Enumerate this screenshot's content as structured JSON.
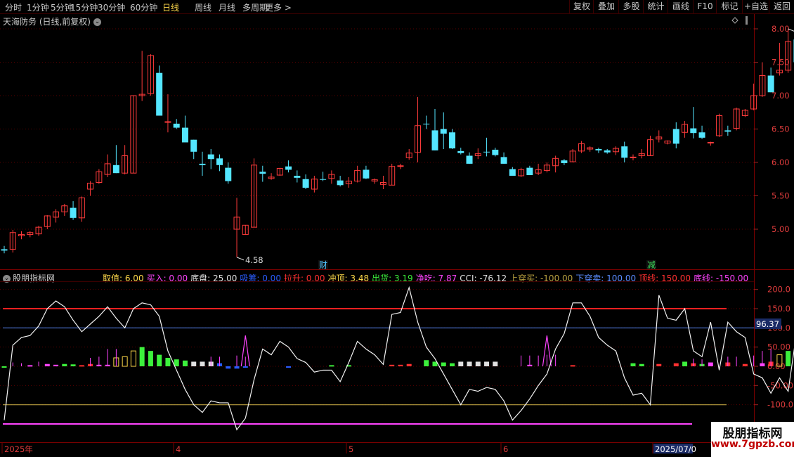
{
  "toolbar": {
    "periods": [
      "分时",
      "1分钟",
      "5分钟",
      "15分钟",
      "30分钟",
      "60分钟",
      "日线",
      "周线",
      "月线",
      "多周期",
      "更多 >"
    ],
    "active": "日线",
    "right": [
      "复权",
      "叠加",
      "多股",
      "统计",
      "画线",
      "F10",
      "标记",
      "+自选",
      "返回"
    ]
  },
  "main": {
    "title": "天海防务 (日线,前复权)",
    "y_ticks": [
      "8.00",
      "7.50",
      "7.00",
      "6.50",
      "6.00",
      "5.50",
      "5.00"
    ],
    "max_label": "8.00",
    "min_label": "4.58",
    "markers": [
      {
        "text": "财",
        "color": "#4fc3ff"
      },
      {
        "text": "减",
        "color": "#3cd85a"
      }
    ]
  },
  "indicator": {
    "title": "股朋指标网",
    "legend": [
      {
        "text": "取值: 6.00",
        "color": "#ffd94a"
      },
      {
        "text": "买入: 0.00",
        "color": "#ff44ff"
      },
      {
        "text": "底盘: 25.00",
        "color": "#e0e0e0"
      },
      {
        "text": "吸筹: 0.00",
        "color": "#2a5cff"
      },
      {
        "text": "拉升: 0.00",
        "color": "#ff3030"
      },
      {
        "text": "冲顶: 3.48",
        "color": "#ffd94a"
      },
      {
        "text": "出货: 3.19",
        "color": "#3cf03c"
      },
      {
        "text": "净吃: 7.87",
        "color": "#ff44ff"
      },
      {
        "text": "CCI: -76.12",
        "color": "#e0e0e0"
      },
      {
        "text": "上穿买: -100.00",
        "color": "#b8a040"
      },
      {
        "text": "下穿卖: 100.00",
        "color": "#5a8cff"
      },
      {
        "text": "顶线: 150.00",
        "color": "#ff3030"
      },
      {
        "text": "底线: -150.00",
        "color": "#ff44ff"
      }
    ],
    "y_ticks": [
      "200.0",
      "150.0",
      "100.0",
      "50.00",
      "0.00",
      "-50.00",
      "-100.0"
    ],
    "current_value": "96.37"
  },
  "time_axis": [
    "2025年",
    "4",
    "5",
    "6",
    "2025/07/0"
  ],
  "watermark": {
    "line1": "股朋指标网",
    "line2": "www.7gpzb.com"
  },
  "colors": {
    "up": "#ff3b3b",
    "down": "#54e6ff",
    "grid": "#5a0000"
  },
  "chart_data": {
    "type": "candlestick",
    "ohlc": [
      [
        4.7,
        4.75,
        4.64,
        4.68
      ],
      [
        4.7,
        4.99,
        4.65,
        4.95
      ],
      [
        4.9,
        4.97,
        4.85,
        4.92
      ],
      [
        4.92,
        4.97,
        4.88,
        4.95
      ],
      [
        4.93,
        5.05,
        4.9,
        5.03
      ],
      [
        5.04,
        5.21,
        5.0,
        5.2
      ],
      [
        5.18,
        5.3,
        5.1,
        5.26
      ],
      [
        5.26,
        5.38,
        5.2,
        5.35
      ],
      [
        5.32,
        5.42,
        5.14,
        5.17
      ],
      [
        5.17,
        5.49,
        5.11,
        5.47
      ],
      [
        5.6,
        5.72,
        5.5,
        5.69
      ],
      [
        5.7,
        5.9,
        5.68,
        5.86
      ],
      [
        5.82,
        6.12,
        5.78,
        5.98
      ],
      [
        5.96,
        6.26,
        5.84,
        5.84
      ],
      [
        5.84,
        6.26,
        5.82,
        6.1
      ],
      [
        5.84,
        7.0,
        5.84,
        7.0
      ],
      [
        7.0,
        7.67,
        6.92,
        7.02
      ],
      [
        7.03,
        7.62,
        7.0,
        7.6
      ],
      [
        7.34,
        7.45,
        6.7,
        6.7
      ],
      [
        6.6,
        7.02,
        6.45,
        6.61
      ],
      [
        6.58,
        6.65,
        6.5,
        6.52
      ],
      [
        6.52,
        6.7,
        6.3,
        6.3
      ],
      [
        6.34,
        6.34,
        6.05,
        6.16
      ],
      [
        5.98,
        6.16,
        5.8,
        5.96
      ],
      [
        6.12,
        6.2,
        5.9,
        6.05
      ],
      [
        6.06,
        6.12,
        5.87,
        5.96
      ],
      [
        5.92,
        6.0,
        5.68,
        5.72
      ],
      [
        5.0,
        5.47,
        4.58,
        5.18
      ],
      [
        4.92,
        5.06,
        4.92,
        5.06
      ],
      [
        5.03,
        6.06,
        5.03,
        5.96
      ],
      [
        5.86,
        5.95,
        5.71,
        5.83
      ],
      [
        5.76,
        5.84,
        5.74,
        5.78
      ],
      [
        5.81,
        5.92,
        5.8,
        5.91
      ],
      [
        5.94,
        6.03,
        5.85,
        5.89
      ],
      [
        5.8,
        5.88,
        5.7,
        5.77
      ],
      [
        5.75,
        5.82,
        5.6,
        5.62
      ],
      [
        5.6,
        5.8,
        5.55,
        5.75
      ],
      [
        5.75,
        5.86,
        5.72,
        5.74
      ],
      [
        5.76,
        5.88,
        5.68,
        5.82
      ],
      [
        5.73,
        5.8,
        5.64,
        5.66
      ],
      [
        5.68,
        5.78,
        5.62,
        5.72
      ],
      [
        5.72,
        5.95,
        5.7,
        5.88
      ],
      [
        5.89,
        5.95,
        5.75,
        5.76
      ],
      [
        5.72,
        5.76,
        5.68,
        5.74
      ],
      [
        5.67,
        5.8,
        5.6,
        5.7
      ],
      [
        5.66,
        5.98,
        5.66,
        5.94
      ],
      [
        5.94,
        5.98,
        5.9,
        5.95
      ],
      [
        6.07,
        6.2,
        6.04,
        6.14
      ],
      [
        6.15,
        6.98,
        6.0,
        6.55
      ],
      [
        6.58,
        6.7,
        6.5,
        6.57
      ],
      [
        6.48,
        6.8,
        6.18,
        6.18
      ],
      [
        6.5,
        6.75,
        6.2,
        6.43
      ],
      [
        6.45,
        6.5,
        6.2,
        6.21
      ],
      [
        6.17,
        6.22,
        6.12,
        6.14
      ],
      [
        6.1,
        6.15,
        5.98,
        5.98
      ],
      [
        6.1,
        6.21,
        6.05,
        6.13
      ],
      [
        6.16,
        6.37,
        6.09,
        6.15
      ],
      [
        6.19,
        6.22,
        6.09,
        6.11
      ],
      [
        6.08,
        6.15,
        5.98,
        5.98
      ],
      [
        5.9,
        5.93,
        5.8,
        5.8
      ],
      [
        5.8,
        5.92,
        5.78,
        5.89
      ],
      [
        5.92,
        5.95,
        5.81,
        5.81
      ],
      [
        5.84,
        5.98,
        5.81,
        5.89
      ],
      [
        5.88,
        6.0,
        5.85,
        5.96
      ],
      [
        5.95,
        6.1,
        5.85,
        6.06
      ],
      [
        6.03,
        6.05,
        5.96,
        5.99
      ],
      [
        6.01,
        6.2,
        6.0,
        6.17
      ],
      [
        6.17,
        6.32,
        6.14,
        6.28
      ],
      [
        6.2,
        6.24,
        6.16,
        6.22
      ],
      [
        6.2,
        6.22,
        6.14,
        6.18
      ],
      [
        6.18,
        6.2,
        6.13,
        6.15
      ],
      [
        6.16,
        6.24,
        6.11,
        6.21
      ],
      [
        6.24,
        6.31,
        6.0,
        6.07
      ],
      [
        6.07,
        6.12,
        6.03,
        6.08
      ],
      [
        6.1,
        6.2,
        6.06,
        6.13
      ],
      [
        6.1,
        6.4,
        6.1,
        6.34
      ],
      [
        6.35,
        6.48,
        6.3,
        6.38
      ],
      [
        6.29,
        6.33,
        6.27,
        6.32
      ],
      [
        6.5,
        6.6,
        6.21,
        6.28
      ],
      [
        6.45,
        6.62,
        6.37,
        6.57
      ],
      [
        6.51,
        6.83,
        6.36,
        6.44
      ],
      [
        6.45,
        6.55,
        6.35,
        6.37
      ],
      [
        6.3,
        6.31,
        6.25,
        6.3
      ],
      [
        6.4,
        6.73,
        6.38,
        6.7
      ],
      [
        6.48,
        6.55,
        6.4,
        6.46
      ],
      [
        6.51,
        6.82,
        6.48,
        6.8
      ],
      [
        6.7,
        6.8,
        6.68,
        6.78
      ],
      [
        6.8,
        7.18,
        6.78,
        7.0
      ],
      [
        7.0,
        7.5,
        6.98,
        7.3
      ],
      [
        7.3,
        7.42,
        7.05,
        7.05
      ],
      [
        7.34,
        7.79,
        7.3,
        7.38
      ],
      [
        7.38,
        8.0,
        7.34,
        7.81
      ],
      [
        7.84,
        7.96,
        7.4,
        7.5
      ],
      [
        7.36,
        7.5,
        7.05,
        7.15
      ],
      [
        7.04,
        7.2,
        6.9,
        6.9
      ],
      [
        6.98,
        7.05,
        6.86,
        6.86
      ],
      [
        6.98,
        7.04,
        6.98,
        7.03
      ],
      [
        7.04,
        7.14,
        6.98,
        7.04
      ],
      [
        6.99,
        7.22,
        6.98,
        7.04
      ],
      [
        6.99,
        7.0,
        6.85,
        6.94
      ]
    ],
    "cci": [
      -140,
      55,
      75,
      80,
      105,
      150,
      170,
      155,
      120,
      90,
      110,
      130,
      155,
      125,
      100,
      150,
      165,
      160,
      130,
      40,
      -10,
      -60,
      -100,
      -120,
      -90,
      -95,
      -95,
      -165,
      -135,
      -35,
      45,
      30,
      65,
      50,
      20,
      10,
      -15,
      -10,
      -10,
      -40,
      10,
      65,
      45,
      30,
      5,
      135,
      140,
      205,
      115,
      50,
      20,
      -20,
      -60,
      -100,
      -60,
      -65,
      -55,
      -60,
      -90,
      -140,
      -115,
      -85,
      -50,
      -20,
      45,
      85,
      165,
      165,
      130,
      75,
      55,
      40,
      -30,
      -75,
      -70,
      -100,
      185,
      125,
      120,
      150,
      40,
      25,
      115,
      -10,
      115,
      90,
      75,
      -20,
      -30,
      -70,
      -30,
      -65,
      90,
      55,
      65,
      85,
      -30,
      -55,
      -50,
      -45,
      -60,
      -75
    ],
    "bars": [
      {
        "i": 0,
        "v": -3,
        "c": "#3cf03c"
      },
      {
        "i": 3,
        "v": 3,
        "c": "#ff44ff"
      },
      {
        "i": 5,
        "v": 6,
        "c": "#ff44ff"
      },
      {
        "i": 6,
        "v": 4,
        "c": "#ff44ff"
      },
      {
        "i": 7,
        "v": 6,
        "c": "#3cf03c"
      },
      {
        "i": 8,
        "v": 5,
        "c": "#3cf03c"
      },
      {
        "i": 9,
        "v": 3,
        "c": "#ff3030"
      },
      {
        "i": 10,
        "v": 6,
        "c": "#ff3030"
      },
      {
        "i": 11,
        "v": 4,
        "c": "#ff44ff"
      },
      {
        "i": 12,
        "v": 4,
        "c": "#ff44ff"
      },
      {
        "i": 13,
        "v": 22,
        "c": "#ffd94a",
        "h": true
      },
      {
        "i": 14,
        "v": 25,
        "c": "#ffd94a",
        "h": true
      },
      {
        "i": 15,
        "v": 40,
        "c": "#ffd94a",
        "h": true
      },
      {
        "i": 16,
        "v": 50,
        "c": "#3cf03c"
      },
      {
        "i": 17,
        "v": 40,
        "c": "#3cf03c"
      },
      {
        "i": 18,
        "v": 30,
        "c": "#3cf03c"
      },
      {
        "i": 19,
        "v": 22,
        "c": "#3cf03c"
      },
      {
        "i": 20,
        "v": 18,
        "c": "#3cf03c"
      },
      {
        "i": 21,
        "v": 15,
        "c": "#3cf03c"
      },
      {
        "i": 22,
        "v": 12,
        "c": "#e0e0e0"
      },
      {
        "i": 23,
        "v": 12,
        "c": "#e0e0e0"
      },
      {
        "i": 24,
        "v": 12,
        "c": "#e0e0e0"
      },
      {
        "i": 25,
        "v": 8,
        "c": "#2a5cff"
      },
      {
        "i": 26,
        "v": -6,
        "c": "#2a5cff"
      },
      {
        "i": 27,
        "v": -6,
        "c": "#2a5cff"
      },
      {
        "i": 28,
        "v": -3,
        "c": "#2a5cff"
      },
      {
        "i": 33,
        "v": -3,
        "c": "#2a5cff"
      },
      {
        "i": 38,
        "v": 3,
        "c": "#3cf03c"
      },
      {
        "i": 40,
        "v": 3,
        "c": "#3cf03c"
      },
      {
        "i": 45,
        "v": 4,
        "c": "#ff3030"
      },
      {
        "i": 46,
        "v": 4,
        "c": "#ff3030"
      },
      {
        "i": 47,
        "v": 6,
        "c": "#ff3030"
      },
      {
        "i": 49,
        "v": 16,
        "c": "#3cf03c"
      },
      {
        "i": 50,
        "v": 12,
        "c": "#3cf03c"
      },
      {
        "i": 51,
        "v": 10,
        "c": "#3cf03c"
      },
      {
        "i": 52,
        "v": 8,
        "c": "#3cf03c"
      },
      {
        "i": 53,
        "v": 12,
        "c": "#e0e0e0"
      },
      {
        "i": 54,
        "v": 12,
        "c": "#e0e0e0"
      },
      {
        "i": 55,
        "v": 12,
        "c": "#e0e0e0"
      },
      {
        "i": 56,
        "v": 12,
        "c": "#e0e0e0"
      },
      {
        "i": 57,
        "v": 12,
        "c": "#e0e0e0"
      },
      {
        "i": 61,
        "v": 4,
        "c": "#ff44ff"
      },
      {
        "i": 66,
        "v": 3,
        "c": "#ff3030"
      },
      {
        "i": 73,
        "v": 8,
        "c": "#3cf03c"
      },
      {
        "i": 74,
        "v": 6,
        "c": "#3cf03c"
      },
      {
        "i": 76,
        "v": 6,
        "c": "#ff3030"
      },
      {
        "i": 78,
        "v": 8,
        "c": "#ff3030"
      },
      {
        "i": 79,
        "v": 12,
        "c": "#3cf03c"
      },
      {
        "i": 80,
        "v": 8,
        "c": "#ff3030"
      },
      {
        "i": 81,
        "v": 6,
        "c": "#3cf03c"
      },
      {
        "i": 82,
        "v": 10,
        "c": "#ff44ff"
      },
      {
        "i": 84,
        "v": 10,
        "c": "#ff3030"
      },
      {
        "i": 86,
        "v": 6,
        "c": "#ff3030"
      },
      {
        "i": 88,
        "v": 8,
        "c": "#ff44ff"
      },
      {
        "i": 89,
        "v": 12,
        "c": "#ff3030"
      },
      {
        "i": 90,
        "v": 30,
        "c": "#ffd94a",
        "h": true
      },
      {
        "i": 91,
        "v": 40,
        "c": "#3cf03c"
      },
      {
        "i": 92,
        "v": 28,
        "c": "#3cf03c"
      },
      {
        "i": 93,
        "v": 24,
        "c": "#3cf03c"
      },
      {
        "i": 94,
        "v": 22,
        "c": "#3cf03c"
      },
      {
        "i": 95,
        "v": 18,
        "c": "#3cf03c"
      },
      {
        "i": 96,
        "v": 16,
        "c": "#3cf03c"
      },
      {
        "i": 97,
        "v": 14,
        "c": "#3cf03c"
      }
    ],
    "ticks": [
      {
        "i": 1,
        "v": 10
      },
      {
        "i": 2,
        "v": 8
      },
      {
        "i": 4,
        "v": 12
      },
      {
        "i": 10,
        "v": 22
      },
      {
        "i": 11,
        "v": 25
      },
      {
        "i": 12,
        "v": 45
      },
      {
        "i": 13,
        "v": 45
      },
      {
        "i": 24,
        "v": 25
      },
      {
        "i": 25,
        "v": 25
      },
      {
        "i": 27,
        "v": 28
      },
      {
        "i": 28,
        "v": 25
      },
      {
        "i": 60,
        "v": 28
      },
      {
        "i": 61,
        "v": 28
      },
      {
        "i": 62,
        "v": 28
      },
      {
        "i": 63,
        "v": 30
      },
      {
        "i": 64,
        "v": 30
      },
      {
        "i": 80,
        "v": 20
      },
      {
        "i": 81,
        "v": 18
      },
      {
        "i": 84,
        "v": 25
      },
      {
        "i": 85,
        "v": 25
      },
      {
        "i": 87,
        "v": 28
      },
      {
        "i": 88,
        "v": 40
      },
      {
        "i": 89,
        "v": 45
      },
      {
        "i": 96,
        "v": 28
      },
      {
        "i": 97,
        "v": 32
      }
    ],
    "spikes": [
      {
        "i": 28,
        "v": 80
      },
      {
        "i": 63,
        "v": 80
      }
    ],
    "hlines": [
      150,
      100,
      -100,
      -150
    ],
    "ylim_price": [
      4.5,
      8.1
    ],
    "ylim_ind": [
      -200,
      210
    ]
  }
}
